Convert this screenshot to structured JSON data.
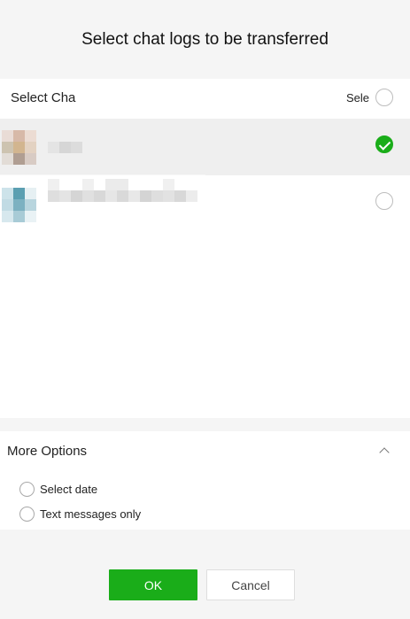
{
  "dialog": {
    "title": "Select chat logs to be transferred"
  },
  "list": {
    "header_title": "Select Cha",
    "select_all_label": "Sele",
    "select_all_checked": false,
    "items": [
      {
        "name": "",
        "checked": true
      },
      {
        "name": "",
        "checked": false
      }
    ]
  },
  "more_options": {
    "title": "More Options",
    "expanded": true,
    "options": [
      {
        "label": "Select date",
        "checked": false
      },
      {
        "label": "Text messages only",
        "checked": false
      }
    ]
  },
  "buttons": {
    "ok_label": "OK",
    "cancel_label": "Cancel"
  },
  "colors": {
    "accent": "#1aad19",
    "background": "#f5f5f5",
    "selected_row": "#efefef"
  }
}
